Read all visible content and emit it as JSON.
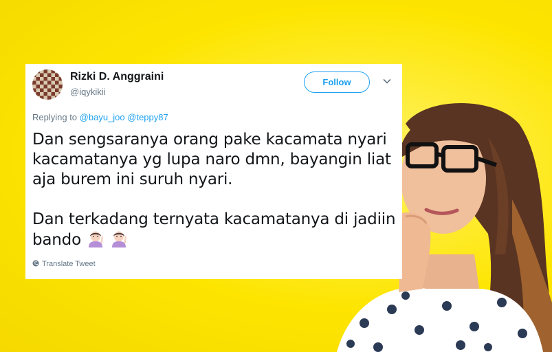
{
  "colors": {
    "background": "#fce800",
    "card": "#ffffff",
    "link_blue": "#1da1f2",
    "muted_gray": "#657786",
    "text_dark": "#14171a"
  },
  "tweet": {
    "author_name": "Rizki D. Anggraini",
    "author_handle": "@iqykikii",
    "follow_label": "Follow",
    "menu_icon": "chevron-down-icon",
    "replying_prefix": "Replying to",
    "mentions": [
      "@bayu_joo",
      "@teppy87"
    ],
    "paragraphs": [
      "Dan sengsaranya orang pake kacamata nyari kacamatanya yg lupa naro dmn, bayangin liat aja burem ini suruh nyari.",
      "Dan terkadang ternyata kacamatanya di jadiin bando"
    ],
    "emojis": [
      "person-raising-hand-emoji",
      "person-raising-hand-emoji"
    ],
    "translate_label": "Translate Tweet"
  },
  "background_image": {
    "subject": "woman-with-glasses-thinking"
  }
}
